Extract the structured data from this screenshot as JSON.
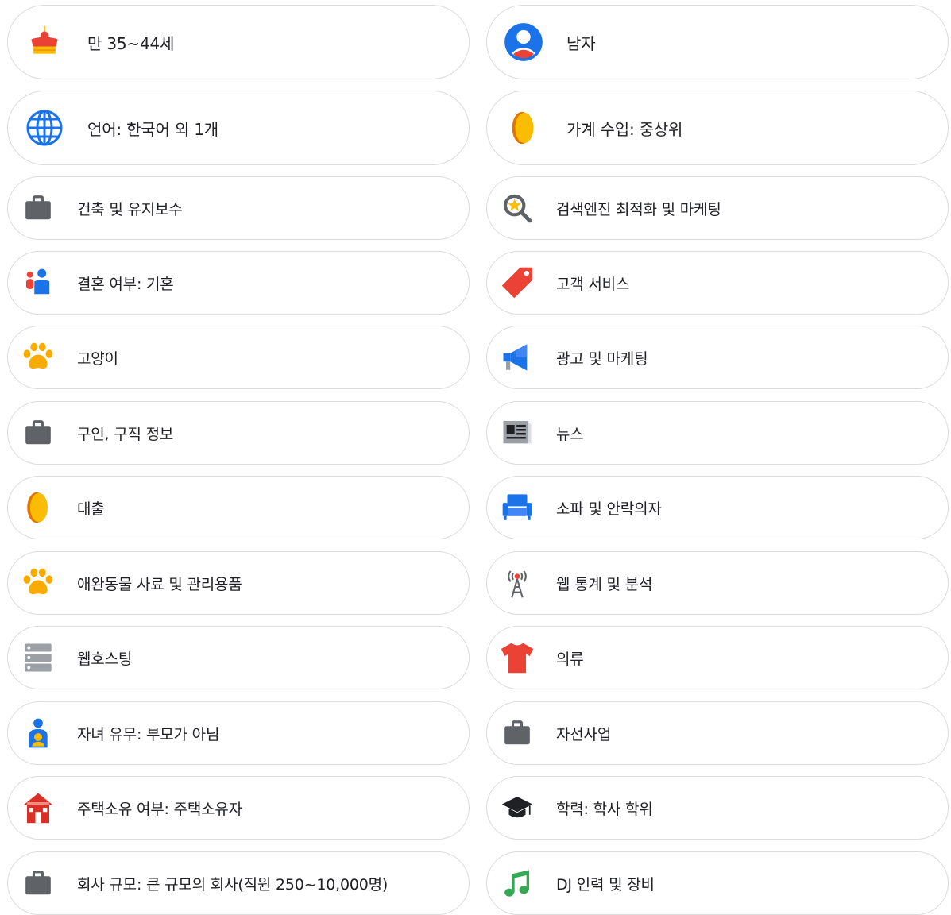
{
  "insights": {
    "left": [
      {
        "id": "age",
        "label": "만 35~44세",
        "icon": "birthday-cake-icon"
      },
      {
        "id": "language",
        "label": "언어: 한국어 외 1개",
        "icon": "globe-icon"
      },
      {
        "id": "construction",
        "label": "건축 및 유지보수",
        "icon": "briefcase-icon"
      },
      {
        "id": "marital",
        "label": "결혼 여부: 기혼",
        "icon": "couple-icon"
      },
      {
        "id": "cats",
        "label": "고양이",
        "icon": "paw-icon"
      },
      {
        "id": "jobs",
        "label": "구인, 구직 정보",
        "icon": "briefcase-icon"
      },
      {
        "id": "loans",
        "label": "대출",
        "icon": "coin-icon"
      },
      {
        "id": "pet-food",
        "label": "애완동물 사료 및 관리용품",
        "icon": "paw-icon"
      },
      {
        "id": "web-hosting",
        "label": "웹호스팅",
        "icon": "server-icon"
      },
      {
        "id": "children",
        "label": "자녀 유무: 부모가 아님",
        "icon": "person-child-icon"
      },
      {
        "id": "homeownership",
        "label": "주택소유 여부: 주택소유자",
        "icon": "house-icon"
      },
      {
        "id": "company-size",
        "label": "회사 규모: 큰 규모의 회사(직원 250~10,000명)",
        "icon": "briefcase-icon"
      }
    ],
    "right": [
      {
        "id": "gender",
        "label": "남자",
        "icon": "account-circle-icon"
      },
      {
        "id": "income",
        "label": "가계 수입: 중상위",
        "icon": "coin-icon"
      },
      {
        "id": "seo",
        "label": "검색엔진 최적화 및 마케팅",
        "icon": "magnifier-star-icon"
      },
      {
        "id": "customer-service",
        "label": "고객 서비스",
        "icon": "price-tag-icon"
      },
      {
        "id": "advertising",
        "label": "광고 및 마케팅",
        "icon": "megaphone-icon"
      },
      {
        "id": "news",
        "label": "뉴스",
        "icon": "newspaper-icon"
      },
      {
        "id": "sofas",
        "label": "소파 및 안락의자",
        "icon": "armchair-icon"
      },
      {
        "id": "web-stats",
        "label": "웹 통계 및 분석",
        "icon": "antenna-icon"
      },
      {
        "id": "apparel",
        "label": "의류",
        "icon": "t-shirt-icon"
      },
      {
        "id": "charity",
        "label": "자선사업",
        "icon": "briefcase-icon"
      },
      {
        "id": "education",
        "label": "학력: 학사 학위",
        "icon": "graduation-cap-icon"
      },
      {
        "id": "dj",
        "label": "DJ 인력 및 장비",
        "icon": "music-note-icon"
      }
    ]
  },
  "colors": {
    "blue": "#1a73e8",
    "red": "#ea4335",
    "yellow": "#fbbc04",
    "green": "#34a853",
    "grey": "#5f6368",
    "orange": "#f29900",
    "border": "#dadce0"
  }
}
